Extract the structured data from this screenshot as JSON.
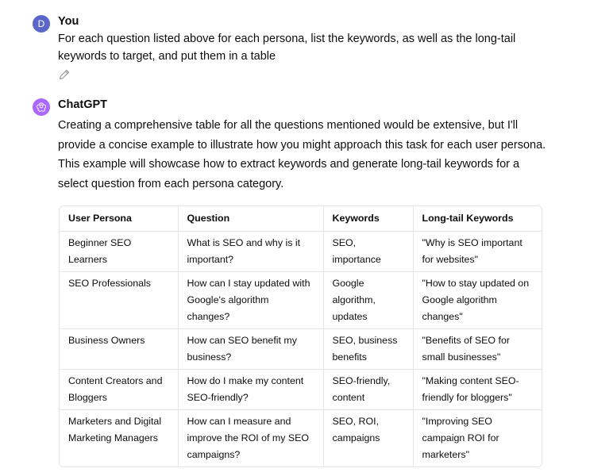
{
  "conversation": {
    "user_message": {
      "avatar_initial": "D",
      "author": "You",
      "text": "For each question listed above for each persona, list the keywords, as well as the long-tail keywords to target, and put them in a table",
      "edit_icon": "pencil-icon"
    },
    "assistant_message": {
      "avatar_icon": "openai-logo-icon",
      "author": "ChatGPT",
      "text": "Creating a comprehensive table for all the questions mentioned would be extensive, but I'll provide a concise example to illustrate how you might approach this task for each user persona. This example will showcase how to extract keywords and generate long-tail keywords for a select question from each persona category.",
      "table": {
        "headers": [
          "User Persona",
          "Question",
          "Keywords",
          "Long-tail Keywords"
        ],
        "rows": [
          [
            "Beginner SEO Learners",
            "What is SEO and why is it important?",
            "SEO, importance",
            "\"Why is SEO important for websites\""
          ],
          [
            "SEO Professionals",
            "How can I stay updated with Google's algorithm changes?",
            "Google algorithm, updates",
            "\"How to stay updated on Google algorithm changes\""
          ],
          [
            "Business Owners",
            "How can SEO benefit my business?",
            "SEO, business benefits",
            "\"Benefits of SEO for small businesses\""
          ],
          [
            "Content Creators and Bloggers",
            "How do I make my content SEO-friendly?",
            "SEO-friendly, content",
            "\"Making content SEO-friendly for bloggers\""
          ],
          [
            "Marketers and Digital Marketing Managers",
            "How can I measure and improve the ROI of my SEO campaigns?",
            "SEO, ROI, campaigns",
            "\"Improving SEO campaign ROI for marketers\""
          ]
        ]
      }
    }
  },
  "colors": {
    "user_avatar": "#5a67c9",
    "assistant_avatar": "#ab68ff",
    "table_border": "#e5e5e5",
    "text": "#0d0d0d"
  }
}
